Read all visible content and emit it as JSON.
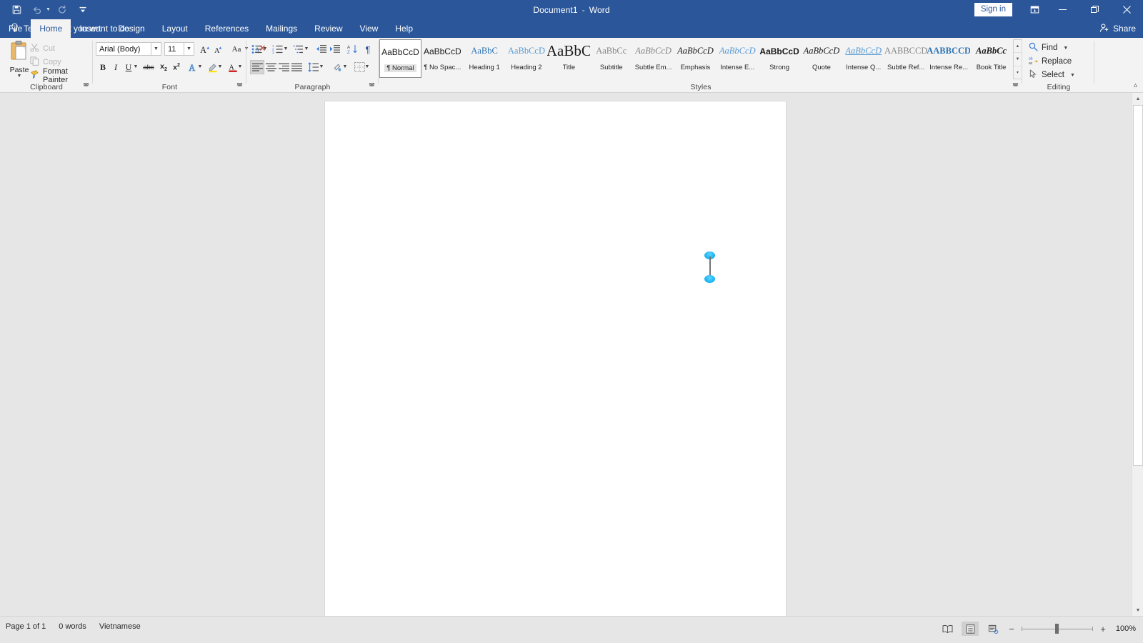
{
  "titlebar": {
    "document_title": "Document1",
    "separator": "-",
    "app_name": "Word",
    "quick_access": [
      {
        "name": "save-icon",
        "glyph": "💾",
        "enabled": true
      },
      {
        "name": "undo-icon",
        "glyph": "↶",
        "enabled": false
      },
      {
        "name": "redo-icon",
        "glyph": "↻",
        "enabled": false
      },
      {
        "name": "customize-quick-access-toolbar-icon",
        "glyph": "☷",
        "enabled": true
      }
    ],
    "sign_in_label": "Sign in",
    "ribbon_display_options": "ribbon-display-options-icon",
    "minimize": "minimize-icon",
    "restore": "restore-icon",
    "close": "close-icon"
  },
  "tabs": [
    {
      "label": "File",
      "active": false
    },
    {
      "label": "Home",
      "active": true
    },
    {
      "label": "Insert",
      "active": false
    },
    {
      "label": "Design",
      "active": false
    },
    {
      "label": "Layout",
      "active": false
    },
    {
      "label": "References",
      "active": false
    },
    {
      "label": "Mailings",
      "active": false
    },
    {
      "label": "Review",
      "active": false
    },
    {
      "label": "View",
      "active": false
    },
    {
      "label": "Help",
      "active": false
    }
  ],
  "tell_me": {
    "label": "Tell me what you want to do",
    "icon": "lightbulb-icon"
  },
  "share": {
    "label": "Share",
    "icon": "share-person-icon"
  },
  "ribbon": {
    "clipboard": {
      "group_label": "Clipboard",
      "paste_label": "Paste",
      "items": [
        {
          "label": "Cut",
          "icon": "scissors-icon",
          "enabled": false
        },
        {
          "label": "Copy",
          "icon": "copy-icon",
          "enabled": false
        },
        {
          "label": "Format Painter",
          "icon": "format-painter-icon",
          "enabled": true
        }
      ]
    },
    "font": {
      "group_label": "Font",
      "font_name": "Arial (Body)",
      "font_size": "11",
      "buttons_row1": [
        {
          "name": "grow-font-button",
          "glyph": "A▴"
        },
        {
          "name": "shrink-font-button",
          "glyph": "A▾"
        },
        {
          "name": "change-case-button",
          "glyph": "Aa"
        },
        {
          "name": "clear-formatting-button",
          "glyph": "A⊘"
        }
      ],
      "buttons_row2": [
        {
          "name": "bold-button",
          "glyph": "B"
        },
        {
          "name": "italic-button",
          "glyph": "I"
        },
        {
          "name": "underline-button",
          "glyph": "U"
        },
        {
          "name": "strikethrough-button",
          "glyph": "abc"
        },
        {
          "name": "subscript-button",
          "glyph": "x₂"
        },
        {
          "name": "superscript-button",
          "glyph": "x²"
        },
        {
          "name": "text-effects-button",
          "glyph": "A"
        },
        {
          "name": "text-highlight-color-button",
          "glyph": "ab"
        },
        {
          "name": "font-color-button",
          "glyph": "A"
        }
      ]
    },
    "paragraph": {
      "group_label": "Paragraph",
      "buttons_row1": [
        {
          "name": "bullets-button"
        },
        {
          "name": "numbering-button"
        },
        {
          "name": "multilevel-list-button"
        },
        {
          "name": "decrease-indent-button"
        },
        {
          "name": "increase-indent-button"
        },
        {
          "name": "sort-button"
        },
        {
          "name": "show-formatting-marks-button"
        }
      ],
      "buttons_row2": [
        {
          "name": "align-left-button",
          "selected": true
        },
        {
          "name": "align-center-button",
          "selected": false
        },
        {
          "name": "align-right-button",
          "selected": false
        },
        {
          "name": "justify-button",
          "selected": false
        },
        {
          "name": "line-spacing-button",
          "selected": false
        },
        {
          "name": "shading-button",
          "selected": false
        },
        {
          "name": "borders-button",
          "selected": false
        }
      ]
    },
    "styles": {
      "group_label": "Styles",
      "items": [
        {
          "name": "Normal",
          "display": "¶ Normal",
          "preview": "AaBbCcD",
          "active": true,
          "classes": "sc-normal"
        },
        {
          "name": "No Spacing",
          "display": "¶ No Spac...",
          "preview": "AaBbCcD",
          "active": false,
          "classes": "sc-normal"
        },
        {
          "name": "Heading 1",
          "display": "Heading 1",
          "preview": "AaBbC",
          "active": false,
          "classes": "sc-blue"
        },
        {
          "name": "Heading 2",
          "display": "Heading 2",
          "preview": "AaBbCcD",
          "active": false,
          "classes": "sc-lblue"
        },
        {
          "name": "Title",
          "display": "Title",
          "preview": "AaBbC",
          "active": false,
          "classes": "sc-big"
        },
        {
          "name": "Subtitle",
          "display": "Subtitle",
          "preview": "AaBbCc",
          "active": false,
          "classes": "sc-gray"
        },
        {
          "name": "Subtle Emphasis",
          "display": "Subtle Em...",
          "preview": "AaBbCcD",
          "active": false,
          "classes": "sc-ital sc-gray"
        },
        {
          "name": "Emphasis",
          "display": "Emphasis",
          "preview": "AaBbCcD",
          "active": false,
          "classes": "sc-ital"
        },
        {
          "name": "Intense Emphasis",
          "display": "Intense E...",
          "preview": "AaBbCcD",
          "active": false,
          "classes": "sc-ital sc-lblue"
        },
        {
          "name": "Strong",
          "display": "Strong",
          "preview": "AaBbCcD",
          "active": false,
          "classes": "sc-bold sc-normal"
        },
        {
          "name": "Quote",
          "display": "Quote",
          "preview": "AaBbCcD",
          "active": false,
          "classes": "sc-ital"
        },
        {
          "name": "Intense Quote",
          "display": "Intense Q...",
          "preview": "AaBbCcD",
          "active": false,
          "classes": "sc-ital sc-lblue sc-uline"
        },
        {
          "name": "Subtle Reference",
          "display": "Subtle Ref...",
          "preview": "AABBCCD",
          "active": false,
          "classes": "sc-caps sc-gray"
        },
        {
          "name": "Intense Reference",
          "display": "Intense Re...",
          "preview": "AABBCCD",
          "active": false,
          "classes": "sc-caps sc-blue sc-bold"
        },
        {
          "name": "Book Title",
          "display": "Book Title",
          "preview": "AaBbCc",
          "active": false,
          "classes": "sc-bold sc-ital"
        }
      ]
    },
    "editing": {
      "group_label": "Editing",
      "items": [
        {
          "label": "Find",
          "icon": "magnifier-icon",
          "has_caret": true
        },
        {
          "label": "Replace",
          "icon": "replace-icon",
          "has_caret": false
        },
        {
          "label": "Select",
          "icon": "select-pointer-icon",
          "has_caret": true
        }
      ]
    },
    "collapse_ribbon": "collapse-ribbon-icon"
  },
  "document": {
    "content": "",
    "cursor": {
      "type": "touch-text-cursor",
      "top_handle": "selection-handle-top",
      "bottom_handle": "selection-handle-bottom",
      "accent_color": "#22b8f5"
    }
  },
  "statusbar": {
    "page_info": "Page 1 of 1",
    "word_count": "0 words",
    "language": "Vietnamese",
    "views": [
      {
        "name": "read-mode-view-button",
        "selected": false
      },
      {
        "name": "print-layout-view-button",
        "selected": true
      },
      {
        "name": "web-layout-view-button",
        "selected": false
      }
    ],
    "zoom_out": "−",
    "zoom_in": "+",
    "zoom_level": "100%"
  },
  "colors": {
    "chrome_blue": "#2b579a",
    "ribbon_bg": "#f3f3f3",
    "workspace_gray": "#e6e6e6",
    "accent_cyan": "#22b8f5"
  }
}
